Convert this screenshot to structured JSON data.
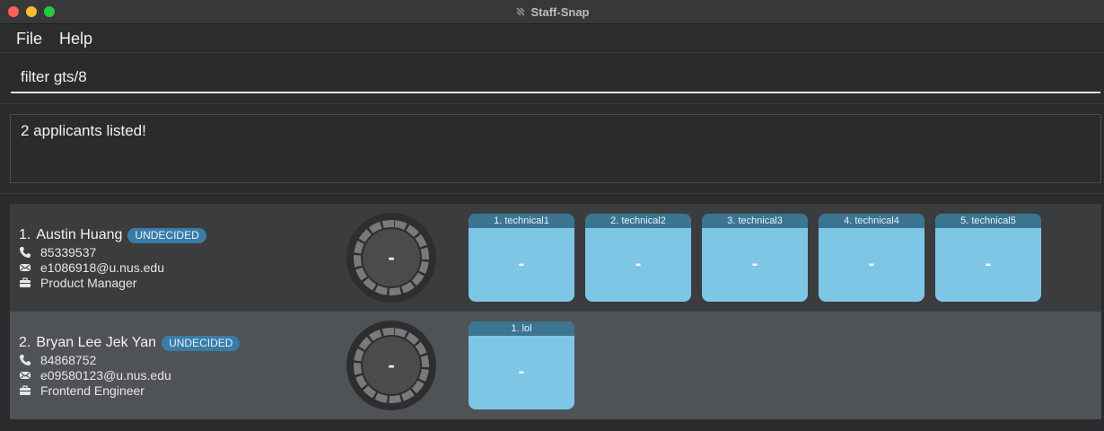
{
  "window": {
    "title": "Staff-Snap"
  },
  "menu": {
    "file": "File",
    "help": "Help"
  },
  "command": {
    "value": "filter gts/8"
  },
  "result": {
    "message": "2 applicants listed!"
  },
  "applicants": [
    {
      "index": "1.",
      "name": "Austin Huang",
      "status": "UNDECIDED",
      "phone": "85339537",
      "email": "e1086918@u.nus.edu",
      "position": "Product Manager",
      "overall_score": "-",
      "interviews": [
        {
          "label": "1. technical1",
          "score": "-"
        },
        {
          "label": "2. technical2",
          "score": "-"
        },
        {
          "label": "3. technical3",
          "score": "-"
        },
        {
          "label": "4. technical4",
          "score": "-"
        },
        {
          "label": "5. technical5",
          "score": "-"
        }
      ]
    },
    {
      "index": "2.",
      "name": "Bryan Lee Jek Yan",
      "status": "UNDECIDED",
      "phone": "84868752",
      "email": "e09580123@u.nus.edu",
      "position": "Frontend Engineer",
      "overall_score": "-",
      "interviews": [
        {
          "label": "1. lol",
          "score": "-"
        }
      ]
    }
  ],
  "colors": {
    "status_badge": "#3a7ca8",
    "interview_card": "#7ec6e6",
    "interview_header": "#3b7592"
  },
  "icons": {
    "phone": "phone-icon",
    "email": "email-icon",
    "position": "briefcase-icon"
  }
}
